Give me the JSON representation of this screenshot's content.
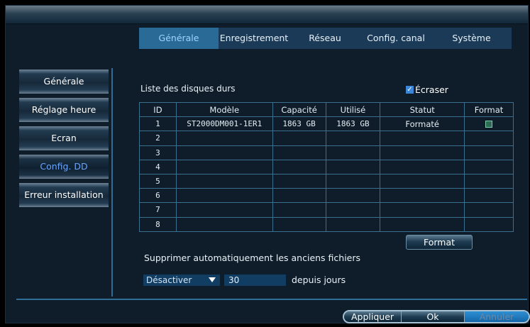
{
  "tabs": [
    {
      "label": "Générale",
      "active": true
    },
    {
      "label": "Enregistrement",
      "active": false
    },
    {
      "label": "Réseau",
      "active": false
    },
    {
      "label": "Config. canal",
      "active": false
    },
    {
      "label": "Système",
      "active": false
    }
  ],
  "sidebar": {
    "items": [
      {
        "label": "Générale"
      },
      {
        "label": "Réglage heure"
      },
      {
        "label": "Ecran"
      },
      {
        "label": "Config. DD",
        "active": true
      },
      {
        "label": "Erreur installation"
      }
    ]
  },
  "hdd": {
    "title": "Liste des disques durs",
    "overwrite_label": "Écraser",
    "overwrite_checked": true,
    "columns": [
      "ID",
      "Modèle",
      "Capacité",
      "Utilisé",
      "Statut",
      "Format"
    ],
    "rows": [
      {
        "id": "1",
        "model": "ST2000DM001-1ER1",
        "capacity": "1863 GB",
        "used": "1863 GB",
        "status": "Formaté"
      },
      {
        "id": "2",
        "model": "",
        "capacity": "",
        "used": "",
        "status": ""
      },
      {
        "id": "3",
        "model": "",
        "capacity": "",
        "used": "",
        "status": ""
      },
      {
        "id": "4",
        "model": "",
        "capacity": "",
        "used": "",
        "status": ""
      },
      {
        "id": "5",
        "model": "",
        "capacity": "",
        "used": "",
        "status": ""
      },
      {
        "id": "6",
        "model": "",
        "capacity": "",
        "used": "",
        "status": ""
      },
      {
        "id": "7",
        "model": "",
        "capacity": "",
        "used": "",
        "status": ""
      },
      {
        "id": "8",
        "model": "",
        "capacity": "",
        "used": "",
        "status": ""
      }
    ],
    "format_button": "Format"
  },
  "auto_delete": {
    "label": "Supprimer automatiquement les anciens fichiers",
    "mode_value": "Désactiver",
    "days_value": "30",
    "days_label": "depuis jours"
  },
  "footer": {
    "apply": "Appliquer",
    "ok": "Ok",
    "cancel": "Annuler"
  },
  "colors": {
    "accent": "#2a6a96",
    "active_text": "#69a5ff",
    "background": "#0f1d2a"
  }
}
